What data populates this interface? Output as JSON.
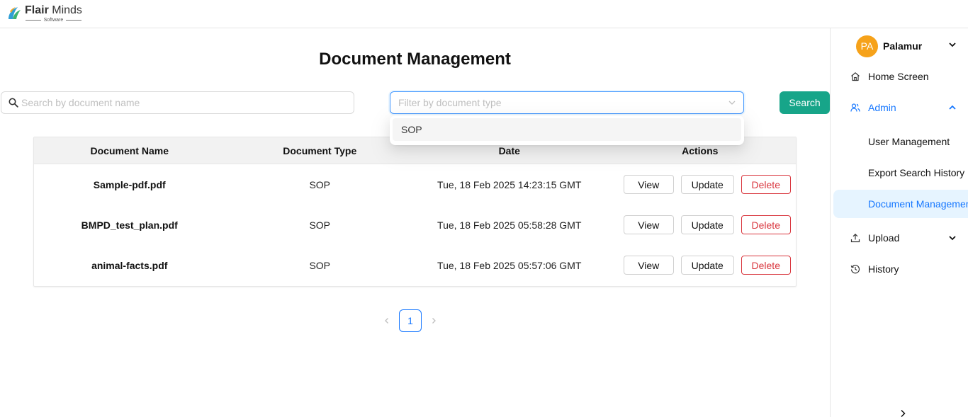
{
  "brand": {
    "name_bold": "Flair",
    "name_rest": " Minds",
    "tagline": "Software"
  },
  "page": {
    "title": "Document Management"
  },
  "search": {
    "placeholder": "Search by document name",
    "button_label": "Search"
  },
  "filter": {
    "placeholder": "Filter by document type",
    "options": [
      "SOP"
    ]
  },
  "table": {
    "columns": [
      "Document Name",
      "Document Type",
      "Date",
      "Actions"
    ],
    "rows": [
      {
        "name": "Sample-pdf.pdf",
        "type": "SOP",
        "date": "Tue, 18 Feb 2025 14:23:15 GMT"
      },
      {
        "name": "BMPD_test_plan.pdf",
        "type": "SOP",
        "date": "Tue, 18 Feb 2025 05:58:28 GMT"
      },
      {
        "name": "animal-facts.pdf",
        "type": "SOP",
        "date": "Tue, 18 Feb 2025 05:57:06 GMT"
      }
    ],
    "action_labels": {
      "view": "View",
      "update": "Update",
      "delete": "Delete"
    }
  },
  "pagination": {
    "current_page": "1"
  },
  "sidebar": {
    "user": {
      "initials": "PA",
      "name": "Palamur"
    },
    "items": [
      {
        "label": "Home Screen",
        "icon": "home-icon"
      },
      {
        "label": "Admin",
        "icon": "admin-users-icon",
        "expanded": true
      },
      {
        "label": "User Management"
      },
      {
        "label": "Export Search History"
      },
      {
        "label": "Document Management",
        "selected": true
      },
      {
        "label": "Upload",
        "icon": "upload-icon"
      },
      {
        "label": "History",
        "icon": "history-icon"
      }
    ]
  },
  "colors": {
    "accent": "#17a589",
    "primary": "#1677ff",
    "danger": "#d9363e",
    "avatar": "#f6a21a"
  }
}
